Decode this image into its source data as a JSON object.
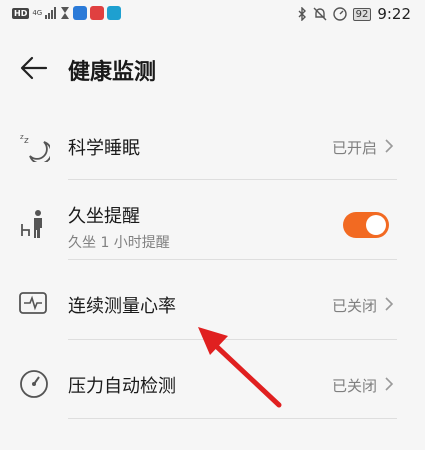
{
  "status_bar": {
    "network": "HD",
    "signal": "4G",
    "battery": "92",
    "time": "9:22"
  },
  "header": {
    "title": "健康监测"
  },
  "items": [
    {
      "label": "科学睡眠",
      "value": "已开启",
      "icon": "sleep-moon-icon"
    },
    {
      "label": "久坐提醒",
      "subtitle": "久坐 1 小时提醒",
      "toggle_on": true,
      "icon": "sedentary-person-icon"
    },
    {
      "label": "连续测量心率",
      "value": "已关闭",
      "icon": "heart-rate-monitor-icon"
    },
    {
      "label": "压力自动检测",
      "value": "已关闭",
      "icon": "pressure-gauge-icon"
    }
  ],
  "colors": {
    "accent": "#f26a22",
    "annotation_arrow": "#e02020"
  }
}
